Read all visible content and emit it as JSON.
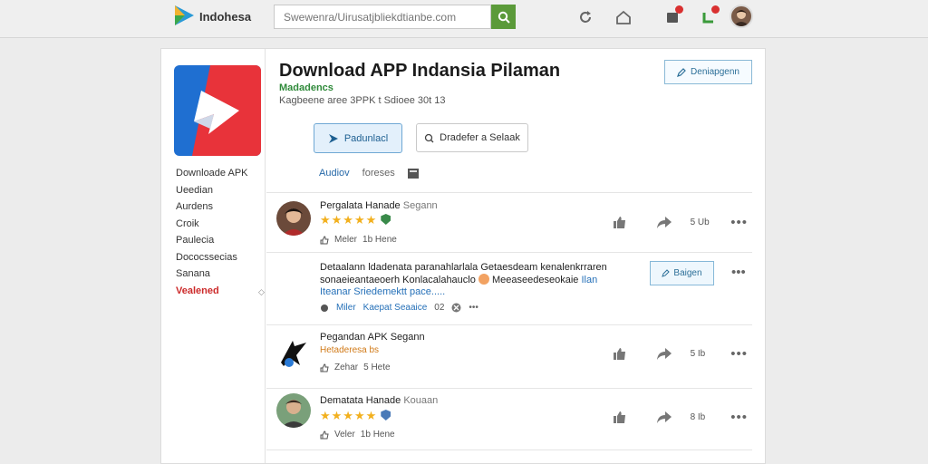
{
  "header": {
    "brand": "Indohesa",
    "search_placeholder": "Swewenra/Uirusatjbliekdtianbe.com",
    "colors": {
      "search_button": "#5b9a3a",
      "badge": "#d93030"
    },
    "icons": [
      "refresh-icon",
      "home-icon",
      "notifications-icon",
      "messages-icon",
      "user-avatar"
    ]
  },
  "sidebar": {
    "items": [
      {
        "label": "Downloade APK",
        "active": false
      },
      {
        "label": "Ueedian",
        "active": false
      },
      {
        "label": "Aurdens",
        "active": false
      },
      {
        "label": "Croik",
        "active": false
      },
      {
        "label": "Paulecia",
        "active": false
      },
      {
        "label": "Dococssecias",
        "active": false
      },
      {
        "label": "Sanana",
        "active": false
      },
      {
        "label": "Vealened",
        "active": true
      }
    ],
    "caret": "◇"
  },
  "app": {
    "title": "Download  APP Indansia Pilaman",
    "developer": "Madadencs",
    "meta": "Kagbeene aree 3PPK t Sdioee 30t 13",
    "follow_label": "Deniapgenn",
    "primary_label": "Padunlacl",
    "secondary_label": "Dradefer a Selaak",
    "colors": {
      "accent_blue": "#2668a8",
      "developer_green": "#2f8a3a",
      "star": "#f2b01e",
      "active_red": "#cc2a2a"
    }
  },
  "tabs": [
    {
      "label": "Audiov",
      "active": true
    },
    {
      "label": "foreses",
      "active": false
    }
  ],
  "reviews": [
    {
      "name": "Pergalata Hanade",
      "name_sub": "Segann",
      "stars": "★★★★★",
      "meta_a": "Meler",
      "meta_b": "1b Hene",
      "count": "5 Ub",
      "more": "•••"
    },
    {
      "text_a": "Detaalann ldadenata paranahlarlala Getaesdeam kenalenkrraren sonaeieantaeoerh Konlacalahauclo",
      "text_b": "Meeaseedeseokaie",
      "text_c": "Ilan",
      "text_d": "Iteanar Sriedemektt pace.....",
      "reply_label": "Baigen",
      "link_a": "Miler",
      "link_b": "Kaepat Seaaice",
      "link_count": "02",
      "more": "•••"
    },
    {
      "name": "Pegandan",
      "name_sub": "APK Segann",
      "sub_line": "Hetaderesa bs",
      "meta_a": "Zehar",
      "meta_b": "5 Hete",
      "count": "5 Ib",
      "more": "•••"
    },
    {
      "name": "Dematata Hanade",
      "name_sub": "Kouaan",
      "stars": "★★★★★",
      "meta_a": "Veler",
      "meta_b": "1b Hene",
      "count": "8 Ib",
      "more": "•••"
    }
  ]
}
